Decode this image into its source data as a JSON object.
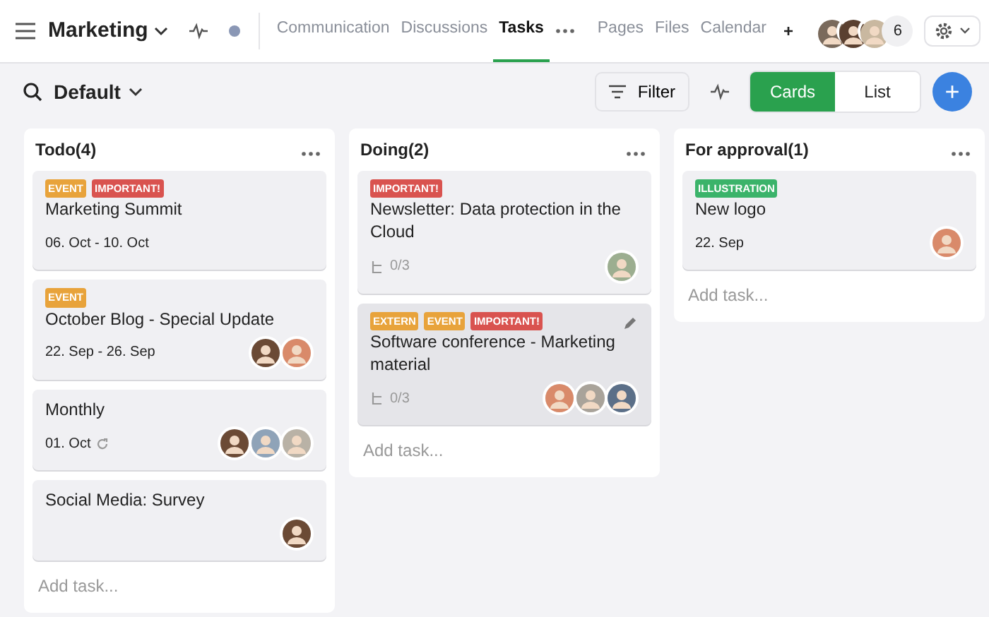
{
  "header": {
    "title": "Marketing",
    "tabs": [
      {
        "label": "Communication",
        "selected": false
      },
      {
        "label": "Discussions",
        "selected": false
      },
      {
        "label": "Tasks",
        "selected": true
      },
      {
        "label": "Pages",
        "selected": false
      },
      {
        "label": "Files",
        "selected": false
      },
      {
        "label": "Calendar",
        "selected": false
      }
    ],
    "add_tab": "+",
    "members": [
      {
        "color": "#7a6a5c"
      },
      {
        "color": "#5a4030"
      },
      {
        "color": "#c9b8a0"
      }
    ],
    "member_count": "6"
  },
  "toolbar": {
    "view_name": "Default",
    "filter": "Filter",
    "views": [
      {
        "label": "Cards",
        "selected": true
      },
      {
        "label": "List",
        "selected": false
      }
    ],
    "add": "+"
  },
  "columns": [
    {
      "title": "Todo(4)",
      "add_task": "Add task...",
      "cards": [
        {
          "tags": [
            {
              "label": "EVENT",
              "color": "#e8a33b"
            },
            {
              "label": "IMPORTANT!",
              "color": "#d9534f"
            }
          ],
          "title": "Marketing Summit",
          "date": "06. Oct - 10. Oct",
          "recurring": false,
          "hovered": false
        },
        {
          "tags": [
            {
              "label": "EVENT",
              "color": "#e8a33b"
            }
          ],
          "title": "October Blog - Special Update",
          "date": "22. Sep - 26. Sep",
          "recurring": false,
          "hovered": false,
          "avatars": [
            {
              "color": "#6b4a35"
            },
            {
              "color": "#d98a6a"
            }
          ]
        },
        {
          "title": "Monthly",
          "date": "01. Oct",
          "recurring": true,
          "hovered": false,
          "avatars": [
            {
              "color": "#6b4a35"
            },
            {
              "color": "#8fa3b8"
            },
            {
              "color": "#b9b2a6"
            }
          ]
        },
        {
          "title": "Social Media: Survey",
          "recurring": false,
          "hovered": false,
          "avatars": [
            {
              "color": "#6b4a35"
            }
          ]
        }
      ]
    },
    {
      "title": "Doing(2)",
      "add_task": "Add task...",
      "cards": [
        {
          "tags": [
            {
              "label": "IMPORTANT!",
              "color": "#d9534f"
            }
          ],
          "title": "Newsletter: Data protection in the Cloud",
          "subtasks": "0/3",
          "recurring": false,
          "hovered": false,
          "avatars": [
            {
              "color": "#9cae90"
            }
          ]
        },
        {
          "tags": [
            {
              "label": "EXTERN",
              "color": "#e8a33b"
            },
            {
              "label": "EVENT",
              "color": "#e8a33b"
            },
            {
              "label": "IMPORTANT!",
              "color": "#d9534f"
            }
          ],
          "title": "Software conference - Marketing material",
          "subtasks": "0/3",
          "recurring": false,
          "hovered": true,
          "avatars": [
            {
              "color": "#d98a6a"
            },
            {
              "color": "#a9a39a"
            },
            {
              "color": "#5b6f88"
            }
          ]
        }
      ]
    },
    {
      "title": "For approval(1)",
      "add_task": "Add task...",
      "cards": [
        {
          "tags": [
            {
              "label": "ILLUSTRATION",
              "color": "#3bb36a"
            }
          ],
          "title": "New logo",
          "date": "22. Sep",
          "recurring": false,
          "hovered": false,
          "avatars": [
            {
              "color": "#d98a6a"
            }
          ]
        }
      ]
    }
  ]
}
